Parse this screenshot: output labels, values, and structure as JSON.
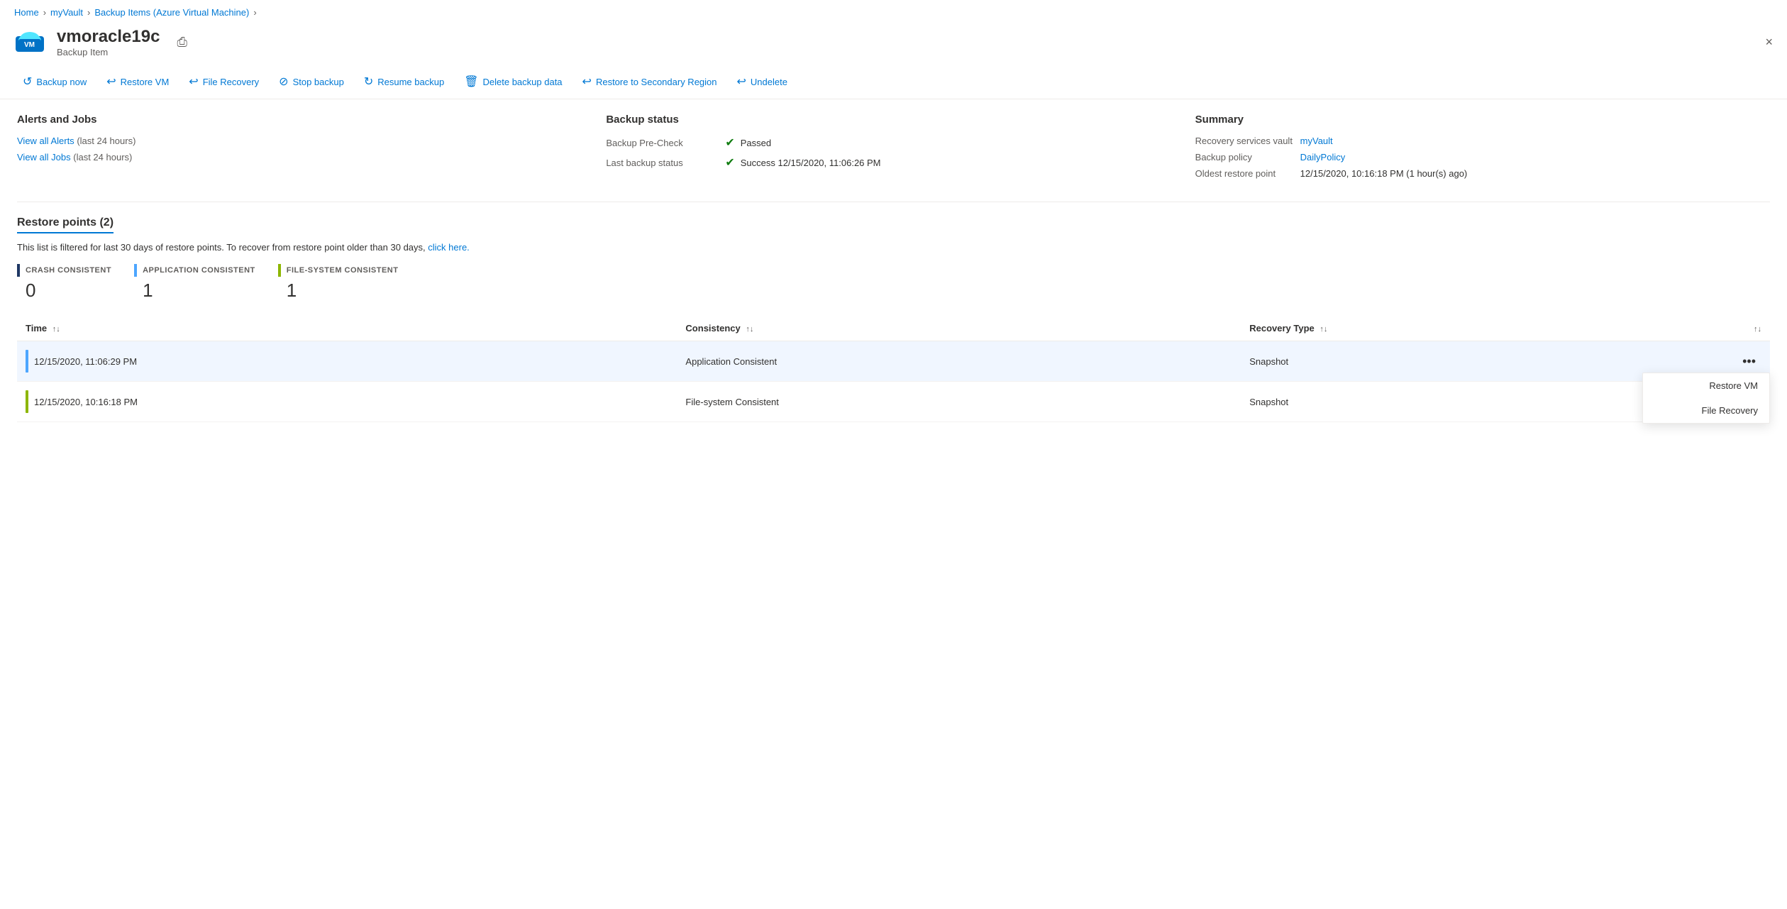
{
  "breadcrumb": {
    "items": [
      "Home",
      "myVault",
      "Backup Items (Azure Virtual Machine)"
    ]
  },
  "header": {
    "title": "vmoracle19c",
    "subtitle": "Backup Item",
    "close_label": "×"
  },
  "toolbar": {
    "buttons": [
      {
        "id": "backup-now",
        "label": "Backup now",
        "icon": "↺"
      },
      {
        "id": "restore-vm",
        "label": "Restore VM",
        "icon": "↩"
      },
      {
        "id": "file-recovery",
        "label": "File Recovery",
        "icon": "↩"
      },
      {
        "id": "stop-backup",
        "label": "Stop backup",
        "icon": "⊘"
      },
      {
        "id": "resume-backup",
        "label": "Resume backup",
        "icon": "↻"
      },
      {
        "id": "delete-backup-data",
        "label": "Delete backup data",
        "icon": "🗑"
      },
      {
        "id": "restore-secondary",
        "label": "Restore to Secondary Region",
        "icon": "↩"
      },
      {
        "id": "undelete",
        "label": "Undelete",
        "icon": "↩"
      }
    ]
  },
  "alerts_section": {
    "title": "Alerts and Jobs",
    "view_alerts_label": "View all Alerts",
    "view_alerts_sub": "(last 24 hours)",
    "view_jobs_label": "View all Jobs",
    "view_jobs_sub": "(last 24 hours)"
  },
  "backup_status_section": {
    "title": "Backup status",
    "rows": [
      {
        "label": "Backup Pre-Check",
        "status": "Passed",
        "status_icon": "✔"
      },
      {
        "label": "Last backup status",
        "status": "Success 12/15/2020, 11:06:26 PM",
        "status_icon": "✔"
      }
    ]
  },
  "summary_section": {
    "title": "Summary",
    "rows": [
      {
        "label": "Recovery services vault",
        "value": "myVault",
        "is_link": true
      },
      {
        "label": "Backup policy",
        "value": "DailyPolicy",
        "is_link": true
      },
      {
        "label": "Oldest restore point",
        "value": "12/15/2020, 10:16:18 PM (1 hour(s) ago)",
        "is_link": false
      }
    ]
  },
  "restore_points": {
    "title": "Restore points (2)",
    "filter_text": "This list is filtered for last 30 days of restore points. To recover from restore point older than 30 days,",
    "filter_link_label": "click here.",
    "consistency_counts": [
      {
        "label": "CRASH CONSISTENT",
        "count": "0",
        "color": "dark-blue"
      },
      {
        "label": "APPLICATION CONSISTENT",
        "count": "1",
        "color": "light-blue"
      },
      {
        "label": "FILE-SYSTEM CONSISTENT",
        "count": "1",
        "color": "yellow-green"
      }
    ],
    "table": {
      "columns": [
        {
          "label": "Time",
          "sortable": true
        },
        {
          "label": "Consistency",
          "sortable": true
        },
        {
          "label": "Recovery Type",
          "sortable": true
        },
        {
          "label": "",
          "sortable": true
        }
      ],
      "rows": [
        {
          "time": "12/15/2020, 11:06:29 PM",
          "consistency": "Application Consistent",
          "recovery_type": "Snapshot",
          "indicator_color": "light-blue",
          "selected": true
        },
        {
          "time": "12/15/2020, 10:16:18 PM",
          "consistency": "File-system Consistent",
          "recovery_type": "Snapshot",
          "indicator_color": "yellow-green",
          "selected": false
        }
      ]
    }
  },
  "context_menu": {
    "visible": true,
    "items": [
      {
        "id": "restore-vm-ctx",
        "label": "Restore VM"
      },
      {
        "id": "file-recovery-ctx",
        "label": "File Recovery"
      }
    ]
  }
}
